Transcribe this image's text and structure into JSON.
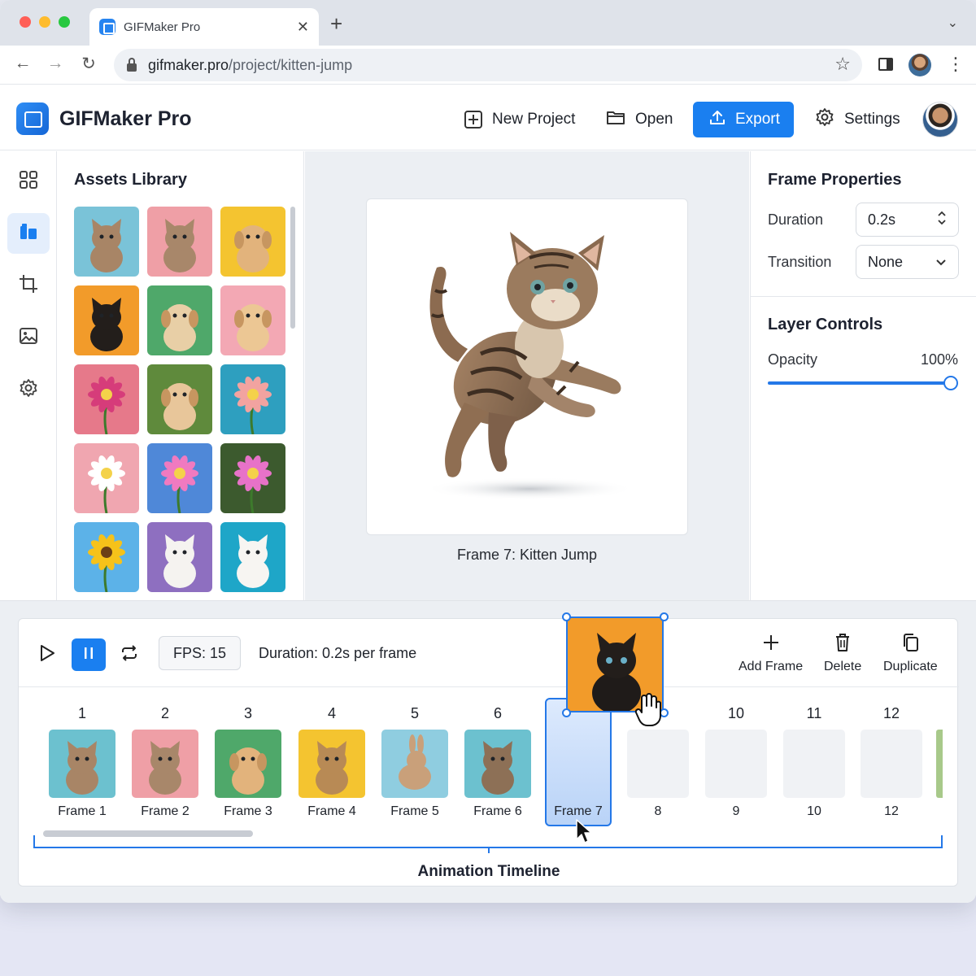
{
  "browser": {
    "tab_title": "GIFMaker Pro",
    "tab_close": "✕",
    "new_tab": "+",
    "tab_menu": "⌄",
    "back": "←",
    "forward": "→",
    "reload": "↻",
    "url_host": "gifmaker.pro",
    "url_path": "/project/kitten-jump",
    "bookmark": "☆",
    "menu": "⋮"
  },
  "app": {
    "title": "GIFMaker Pro",
    "header_buttons": {
      "new_project": "New Project",
      "open": "Open",
      "export": "Export",
      "settings": "Settings"
    },
    "accent": "#1a7ff0"
  },
  "rail": [
    "grid-icon",
    "library-icon",
    "crop-icon",
    "image-icon",
    "gear-icon"
  ],
  "assets": {
    "title": "Assets Library",
    "items": [
      "kitten-tabby-blue",
      "kitten-tabby-pink",
      "puppy-yellow",
      "kitten-black-orange",
      "puppy-green",
      "puppy-pink",
      "flower-pink-dahlia",
      "puppy-grass",
      "flower-peony-teal",
      "flower-daisy-pink",
      "flower-pink-blue",
      "flower-cosmos",
      "sunflower",
      "cat-white-purple",
      "kitten-white-teal"
    ]
  },
  "canvas": {
    "caption": "Frame 7: Kitten Jump"
  },
  "properties": {
    "title": "Frame Properties",
    "duration_label": "Duration",
    "duration_value": "0.2s",
    "transition_label": "Transition",
    "transition_value": "None",
    "layer_title": "Layer Controls",
    "opacity_label": "Opacity",
    "opacity_value": "100%",
    "opacity_fraction": 1.0
  },
  "timeline": {
    "fps": "FPS: 15",
    "duration": "Duration: 0.2s per frame",
    "actions": {
      "add": "Add Frame",
      "delete": "Delete",
      "duplicate": "Duplicate"
    },
    "frames": [
      {
        "num": "1",
        "label": "Frame 1"
      },
      {
        "num": "2",
        "label": "Frame 2"
      },
      {
        "num": "3",
        "label": "Frame 3"
      },
      {
        "num": "4",
        "label": "Frame 4"
      },
      {
        "num": "5",
        "label": "Frame 5"
      },
      {
        "num": "6",
        "label": "Frame 6"
      },
      {
        "num": "",
        "label": "Frame 7"
      },
      {
        "num": "",
        "label": "8"
      },
      {
        "num": "10",
        "label": "9"
      },
      {
        "num": "11",
        "label": "10"
      },
      {
        "num": "12",
        "label": "12"
      }
    ],
    "label": "Animation Timeline"
  }
}
